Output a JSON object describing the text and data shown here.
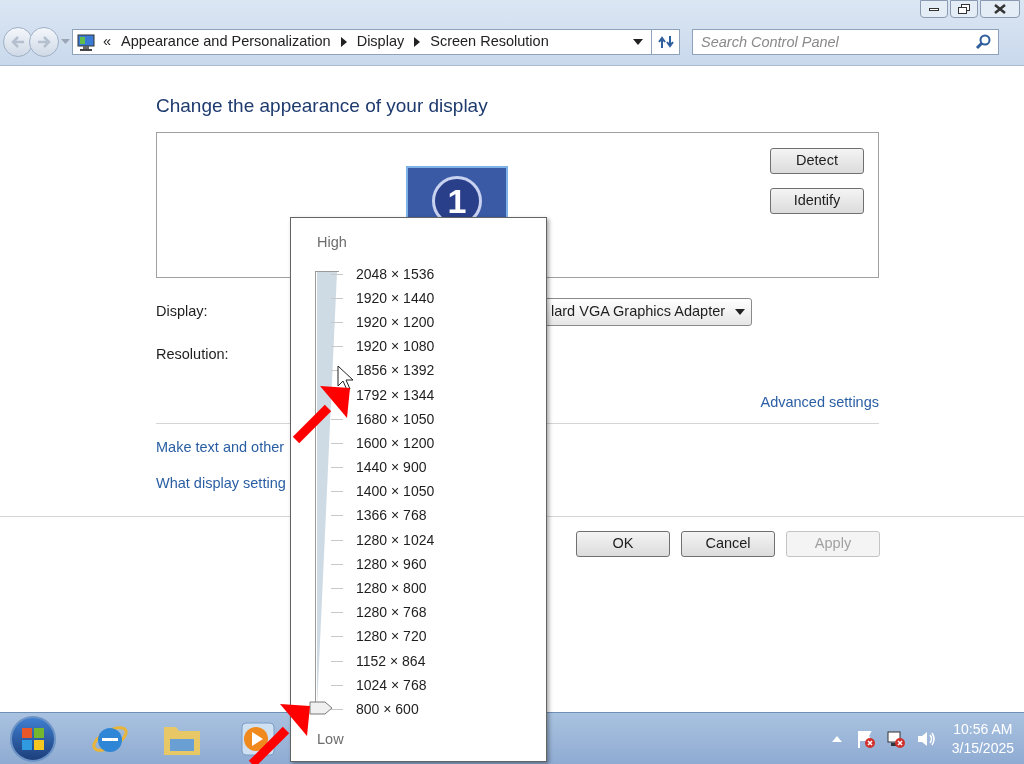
{
  "address_bar": {
    "overflow": "«",
    "crumbs": [
      "Appearance and Personalization",
      "Display",
      "Screen Resolution"
    ]
  },
  "search": {
    "placeholder": "Search Control Panel"
  },
  "heading": "Change the appearance of your display",
  "preview": {
    "display_number": "1",
    "buttons": [
      "Detect",
      "Identify"
    ]
  },
  "display": {
    "label": "Display:",
    "value": "lard VGA Graphics Adapter"
  },
  "resolution": {
    "label": "Resolution:"
  },
  "advanced_link": "Advanced settings",
  "links": [
    "Make text and other",
    "What display setting"
  ],
  "buttons": [
    {
      "label": "OK",
      "disabled": false
    },
    {
      "label": "Cancel",
      "disabled": false
    },
    {
      "label": "Apply",
      "disabled": true
    }
  ],
  "resolution_popup": {
    "high_label": "High",
    "low_label": "Low",
    "level": 0,
    "options": [
      "2048 × 1536",
      "1920 × 1440",
      "1920 × 1200",
      "1920 × 1080",
      "1856 × 1392",
      "1792 × 1344",
      "1680 × 1050",
      "1600 × 1200",
      "1440 × 900",
      "1400 × 1050",
      "1366 × 768",
      "1280 × 1024",
      "1280 × 960",
      "1280 × 800",
      "1280 × 768",
      "1280 × 720",
      "1152 × 864",
      "1024 × 768",
      "800 × 600"
    ]
  },
  "taskbar": {
    "time": "10:56 AM",
    "date": "3/15/2025"
  }
}
